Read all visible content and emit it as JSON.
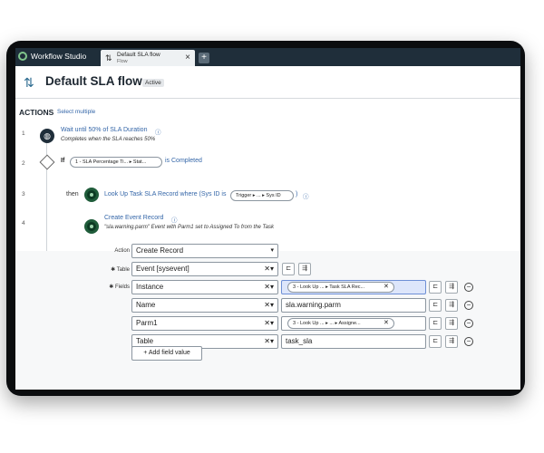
{
  "tabbar": {
    "app_title": "Workflow Studio",
    "tab_title": "Default SLA flow",
    "tab_subtitle": "Flow",
    "tab_close": "×",
    "tab_add": "+"
  },
  "header": {
    "title": "Default SLA flow",
    "badge": "Active"
  },
  "actions": {
    "heading": "ACTIONS",
    "select_multiple": "Select multiple"
  },
  "steps": [
    {
      "num": "1",
      "title": "Wait until 50% of SLA Duration",
      "info": "ⓘ",
      "desc": "Completes when the SLA reaches 50%"
    },
    {
      "num": "2",
      "if_label": "If",
      "pill": "1 - SLA Percentage Ti... ▸ Stat...",
      "condition": "is Completed"
    },
    {
      "num": "3",
      "then_label": "then",
      "title": "Look Up Task SLA Record where (Sys ID is",
      "pill": "Trigger ▸ ... ▸ Sys ID",
      "suffix": ")",
      "info": "ⓘ"
    },
    {
      "num": "4",
      "title": "Create Event Record",
      "info": "ⓘ",
      "desc": "\"sla.warning.parm\" Event with Parm1 set to Assigned To from the Task"
    }
  ],
  "form": {
    "action_label": "Action",
    "action_value": "Create Record",
    "table_label": "✱ Table",
    "table_value": "Event [sysevent]",
    "fields_label": "✱ Fields",
    "rows": [
      {
        "name": "Instance",
        "value": "3 - Look Up ... ▸ Task SLA Rec...",
        "pill": true
      },
      {
        "name": "Name",
        "value": "sla.warning.parm",
        "pill": false
      },
      {
        "name": "Parm1",
        "value": "3 - Look Up ... ▸ ... ▸ Assigne...",
        "pill": true
      },
      {
        "name": "Table",
        "value": "task_sla",
        "pill": false
      }
    ],
    "add_field": "+ Add field value"
  }
}
